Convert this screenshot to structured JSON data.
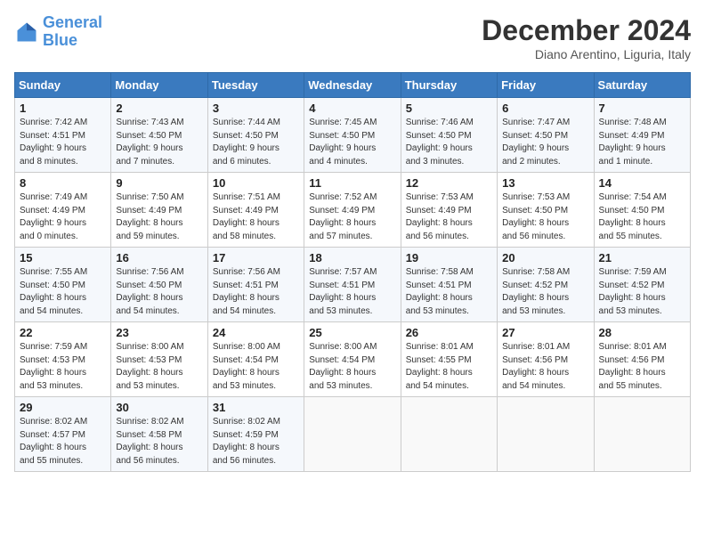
{
  "header": {
    "logo_line1": "General",
    "logo_line2": "Blue",
    "month": "December 2024",
    "location": "Diano Arentino, Liguria, Italy"
  },
  "weekdays": [
    "Sunday",
    "Monday",
    "Tuesday",
    "Wednesday",
    "Thursday",
    "Friday",
    "Saturday"
  ],
  "weeks": [
    [
      {
        "day": 1,
        "info": "Sunrise: 7:42 AM\nSunset: 4:51 PM\nDaylight: 9 hours\nand 8 minutes."
      },
      {
        "day": 2,
        "info": "Sunrise: 7:43 AM\nSunset: 4:50 PM\nDaylight: 9 hours\nand 7 minutes."
      },
      {
        "day": 3,
        "info": "Sunrise: 7:44 AM\nSunset: 4:50 PM\nDaylight: 9 hours\nand 6 minutes."
      },
      {
        "day": 4,
        "info": "Sunrise: 7:45 AM\nSunset: 4:50 PM\nDaylight: 9 hours\nand 4 minutes."
      },
      {
        "day": 5,
        "info": "Sunrise: 7:46 AM\nSunset: 4:50 PM\nDaylight: 9 hours\nand 3 minutes."
      },
      {
        "day": 6,
        "info": "Sunrise: 7:47 AM\nSunset: 4:50 PM\nDaylight: 9 hours\nand 2 minutes."
      },
      {
        "day": 7,
        "info": "Sunrise: 7:48 AM\nSunset: 4:49 PM\nDaylight: 9 hours\nand 1 minute."
      }
    ],
    [
      {
        "day": 8,
        "info": "Sunrise: 7:49 AM\nSunset: 4:49 PM\nDaylight: 9 hours\nand 0 minutes."
      },
      {
        "day": 9,
        "info": "Sunrise: 7:50 AM\nSunset: 4:49 PM\nDaylight: 8 hours\nand 59 minutes."
      },
      {
        "day": 10,
        "info": "Sunrise: 7:51 AM\nSunset: 4:49 PM\nDaylight: 8 hours\nand 58 minutes."
      },
      {
        "day": 11,
        "info": "Sunrise: 7:52 AM\nSunset: 4:49 PM\nDaylight: 8 hours\nand 57 minutes."
      },
      {
        "day": 12,
        "info": "Sunrise: 7:53 AM\nSunset: 4:49 PM\nDaylight: 8 hours\nand 56 minutes."
      },
      {
        "day": 13,
        "info": "Sunrise: 7:53 AM\nSunset: 4:50 PM\nDaylight: 8 hours\nand 56 minutes."
      },
      {
        "day": 14,
        "info": "Sunrise: 7:54 AM\nSunset: 4:50 PM\nDaylight: 8 hours\nand 55 minutes."
      }
    ],
    [
      {
        "day": 15,
        "info": "Sunrise: 7:55 AM\nSunset: 4:50 PM\nDaylight: 8 hours\nand 54 minutes."
      },
      {
        "day": 16,
        "info": "Sunrise: 7:56 AM\nSunset: 4:50 PM\nDaylight: 8 hours\nand 54 minutes."
      },
      {
        "day": 17,
        "info": "Sunrise: 7:56 AM\nSunset: 4:51 PM\nDaylight: 8 hours\nand 54 minutes."
      },
      {
        "day": 18,
        "info": "Sunrise: 7:57 AM\nSunset: 4:51 PM\nDaylight: 8 hours\nand 53 minutes."
      },
      {
        "day": 19,
        "info": "Sunrise: 7:58 AM\nSunset: 4:51 PM\nDaylight: 8 hours\nand 53 minutes."
      },
      {
        "day": 20,
        "info": "Sunrise: 7:58 AM\nSunset: 4:52 PM\nDaylight: 8 hours\nand 53 minutes."
      },
      {
        "day": 21,
        "info": "Sunrise: 7:59 AM\nSunset: 4:52 PM\nDaylight: 8 hours\nand 53 minutes."
      }
    ],
    [
      {
        "day": 22,
        "info": "Sunrise: 7:59 AM\nSunset: 4:53 PM\nDaylight: 8 hours\nand 53 minutes."
      },
      {
        "day": 23,
        "info": "Sunrise: 8:00 AM\nSunset: 4:53 PM\nDaylight: 8 hours\nand 53 minutes."
      },
      {
        "day": 24,
        "info": "Sunrise: 8:00 AM\nSunset: 4:54 PM\nDaylight: 8 hours\nand 53 minutes."
      },
      {
        "day": 25,
        "info": "Sunrise: 8:00 AM\nSunset: 4:54 PM\nDaylight: 8 hours\nand 53 minutes."
      },
      {
        "day": 26,
        "info": "Sunrise: 8:01 AM\nSunset: 4:55 PM\nDaylight: 8 hours\nand 54 minutes."
      },
      {
        "day": 27,
        "info": "Sunrise: 8:01 AM\nSunset: 4:56 PM\nDaylight: 8 hours\nand 54 minutes."
      },
      {
        "day": 28,
        "info": "Sunrise: 8:01 AM\nSunset: 4:56 PM\nDaylight: 8 hours\nand 55 minutes."
      }
    ],
    [
      {
        "day": 29,
        "info": "Sunrise: 8:02 AM\nSunset: 4:57 PM\nDaylight: 8 hours\nand 55 minutes."
      },
      {
        "day": 30,
        "info": "Sunrise: 8:02 AM\nSunset: 4:58 PM\nDaylight: 8 hours\nand 56 minutes."
      },
      {
        "day": 31,
        "info": "Sunrise: 8:02 AM\nSunset: 4:59 PM\nDaylight: 8 hours\nand 56 minutes."
      },
      null,
      null,
      null,
      null
    ]
  ]
}
